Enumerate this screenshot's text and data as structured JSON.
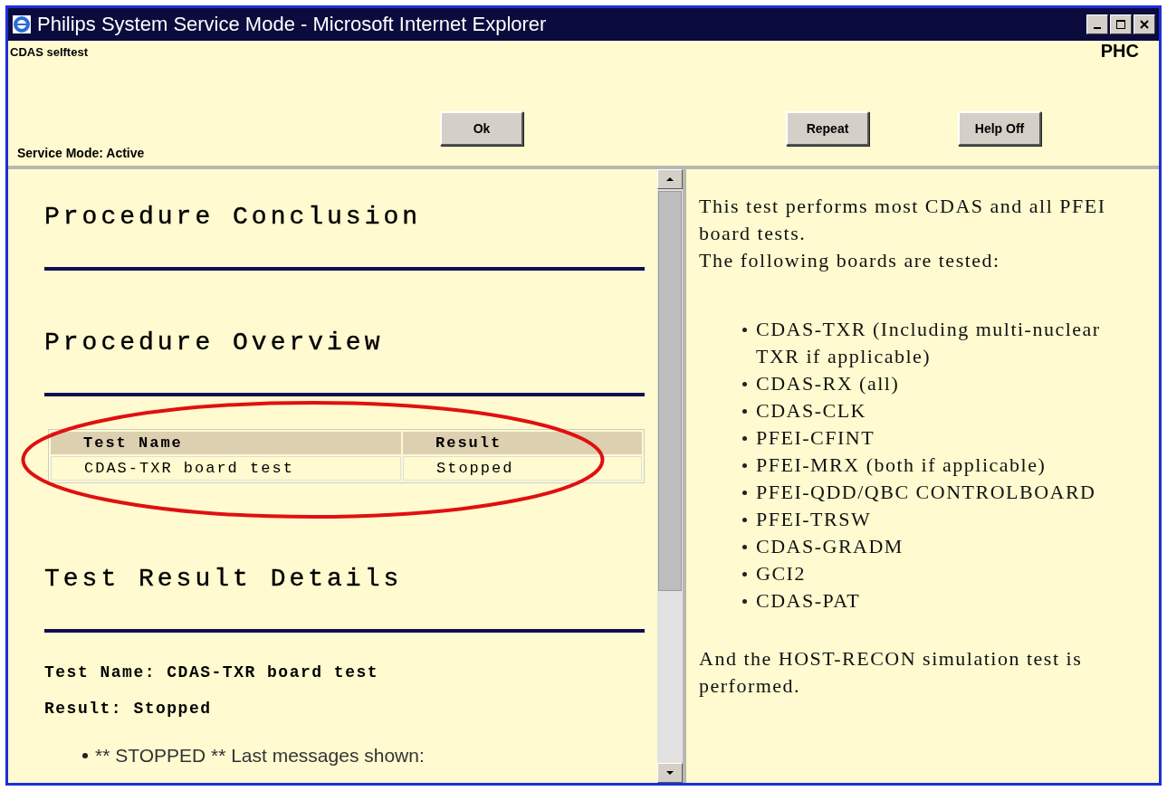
{
  "window": {
    "title": "Philips System Service Mode - Microsoft Internet Explorer"
  },
  "header": {
    "page_label": "CDAS selftest",
    "brand": "PHC",
    "status": "Service Mode: Active",
    "buttons": [
      {
        "label": "Ok"
      },
      {
        "label": "Repeat"
      },
      {
        "label": "Help Off"
      }
    ]
  },
  "left_pane": {
    "sections": [
      {
        "heading": "Procedure Conclusion"
      },
      {
        "heading": "Procedure Overview",
        "table": {
          "circled": true,
          "columns": [
            "Test Name",
            "Result"
          ],
          "rows": [
            [
              "CDAS-TXR board test",
              "Stopped"
            ]
          ]
        }
      },
      {
        "heading": "Test Result Details",
        "details": [
          "Test Name: CDAS-TXR board test",
          "Result: Stopped"
        ],
        "messages": [
          "** STOPPED ** Last messages shown:"
        ]
      }
    ]
  },
  "right_pane": {
    "intro": [
      "This test performs most CDAS and all PFEI board tests.",
      "The following boards are tested:"
    ],
    "boards": [
      "CDAS-TXR (Including multi-nuclear TXR if applicable)",
      "CDAS-RX (all)",
      "CDAS-CLK",
      "PFEI-CFINT",
      "PFEI-MRX (both if applicable)",
      "PFEI-QDD/QBC CONTROLBOARD",
      "PFEI-TRSW",
      "CDAS-GRADM",
      "GCI2",
      "CDAS-PAT"
    ],
    "outro": "And the HOST-RECON simulation test is performed."
  }
}
